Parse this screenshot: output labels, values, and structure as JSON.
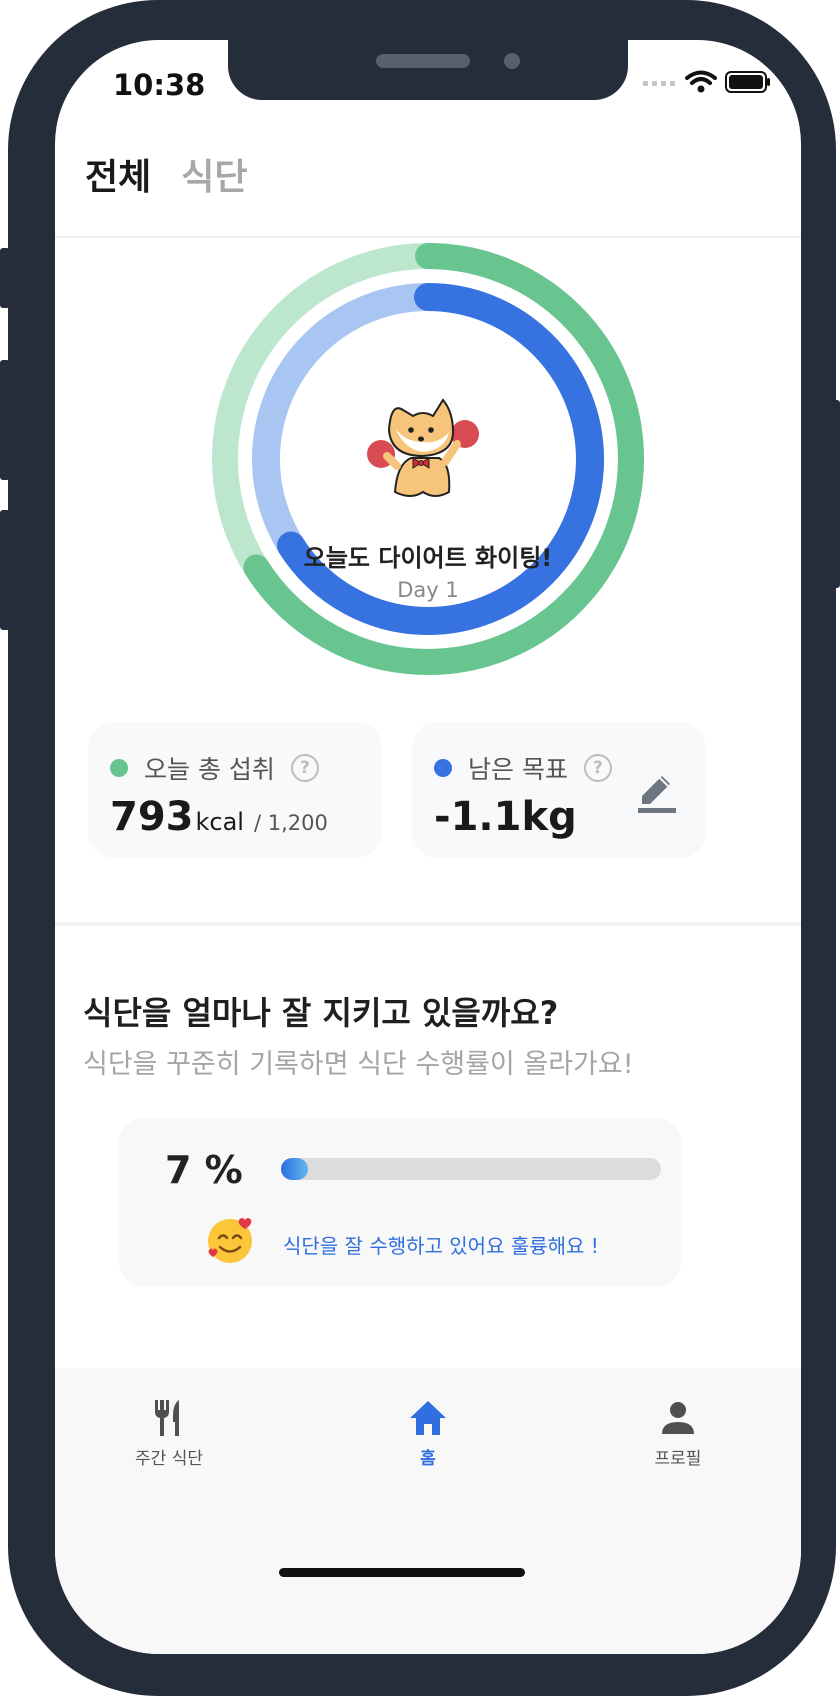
{
  "status_bar": {
    "time": "10:38"
  },
  "tabs": [
    {
      "label": "전체",
      "active": true
    },
    {
      "label": "식단",
      "active": false
    }
  ],
  "ring": {
    "title": "오늘도 다이어트 화이팅!",
    "day": "Day 1",
    "outer_progress_percent": 66,
    "inner_progress_percent": 66,
    "outer_color": "#68c58f",
    "outer_track_color": "#bde6cf",
    "inner_color": "#3672e0",
    "inner_track_color": "#a9c5f2"
  },
  "cards": {
    "intake": {
      "title": "오늘 총 섭취",
      "value": "793",
      "unit": "kcal",
      "goal": "/ 1,200",
      "dot_color": "#68c58f",
      "help_icon": "?"
    },
    "remaining": {
      "title": "남은 목표",
      "value": "-1.1kg",
      "dot_color": "#3672e0",
      "help_icon": "?",
      "edit_icon": "pencil-icon"
    }
  },
  "diet_section": {
    "title": "식단을 얼마나 잘 지키고 있을까요?",
    "subtitle": "식단을 꾸준히 기록하면 식단 수행률이 올라가요!",
    "percent_label": "7 %",
    "percent_value": 7,
    "message": "식단을 잘 수행하고 있어요 훌륭해요 !"
  },
  "bottom_nav": [
    {
      "label": "주간 식단",
      "icon": "fork-knife-icon",
      "active": false
    },
    {
      "label": "홈",
      "icon": "home-icon",
      "active": true
    },
    {
      "label": "프로필",
      "icon": "person-icon",
      "active": false
    }
  ]
}
